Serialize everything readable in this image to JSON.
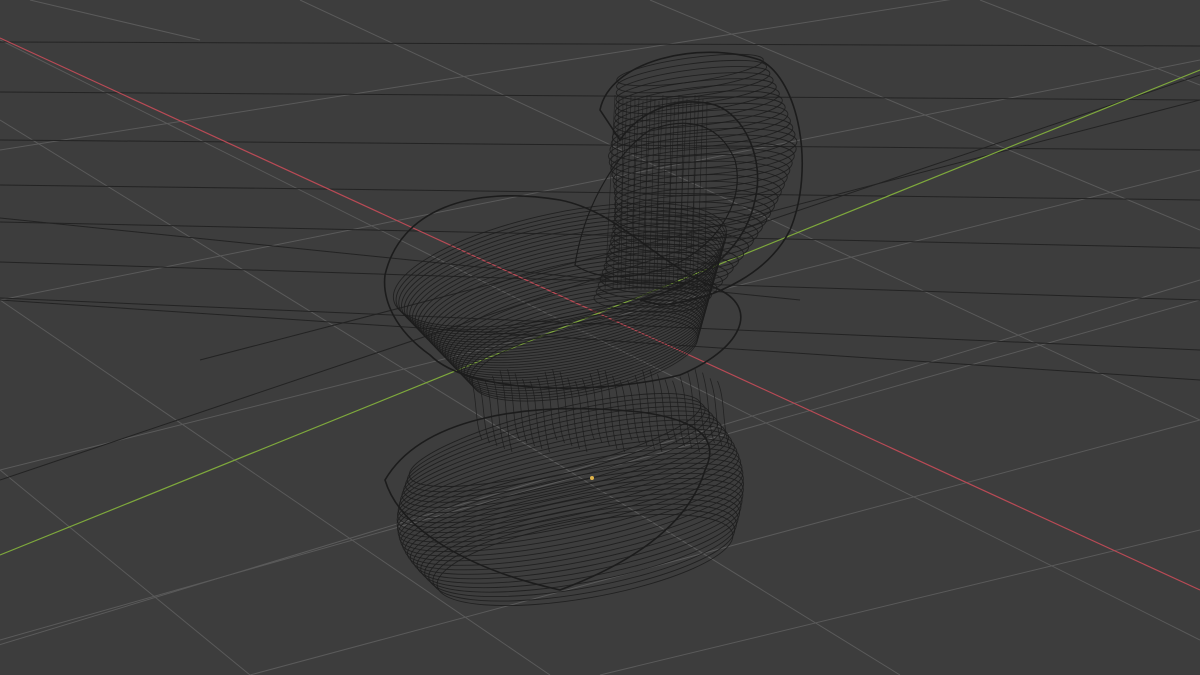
{
  "app": {
    "view_mode": "wireframe",
    "colors": {
      "background": "#3d3d3d",
      "grid_minor": "#5a5a5a",
      "grid_major": "#232323",
      "axis_x": "#b84a55",
      "axis_y": "#7ea83c",
      "wire": "#1c1c1c",
      "object_origin": "#e0b44a"
    }
  },
  "scene": {
    "object": {
      "name": "chair-mesh",
      "display": "wireframe"
    },
    "grid": {
      "visible": true
    },
    "axes": {
      "x_visible": true,
      "y_visible": true
    }
  }
}
